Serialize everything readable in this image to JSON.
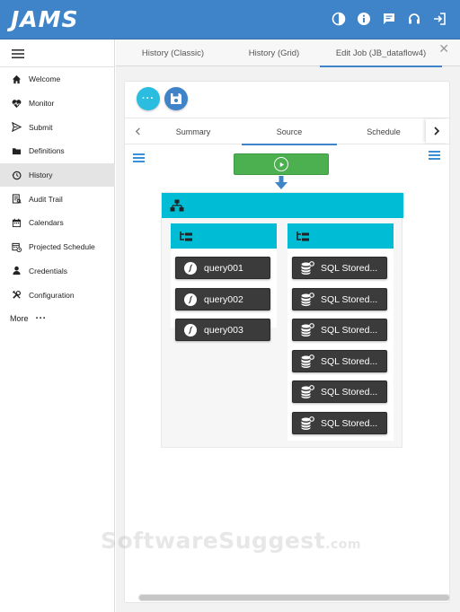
{
  "app": {
    "logo": "JAMS"
  },
  "header": {
    "icons": [
      "contrast-icon",
      "info-icon",
      "chat-icon",
      "headset-icon",
      "logout-icon"
    ]
  },
  "sidebar": {
    "items": [
      {
        "label": "Welcome",
        "icon": "home-icon"
      },
      {
        "label": "Monitor",
        "icon": "heart-pulse-icon"
      },
      {
        "label": "Submit",
        "icon": "send-icon"
      },
      {
        "label": "Definitions",
        "icon": "folder-icon"
      },
      {
        "label": "History",
        "icon": "history-icon",
        "active": true
      },
      {
        "label": "Audit Trail",
        "icon": "audit-icon"
      },
      {
        "label": "Calendars",
        "icon": "calendar-icon"
      },
      {
        "label": "Projected Schedule",
        "icon": "projected-schedule-icon"
      },
      {
        "label": "Credentials",
        "icon": "user-icon"
      },
      {
        "label": "Configuration",
        "icon": "tools-icon"
      }
    ],
    "more_label": "More",
    "more_dots": "..."
  },
  "tabs": [
    {
      "label": "History (Classic)"
    },
    {
      "label": "History (Grid)"
    },
    {
      "label": "Edit Job (JB_dataflow4)",
      "active": true
    }
  ],
  "tab_close": "✕",
  "toolbar": {
    "more_label": "···"
  },
  "subtabs": [
    {
      "label": "Summary"
    },
    {
      "label": "Source",
      "active": true
    },
    {
      "label": "Schedule"
    }
  ],
  "workflow": {
    "left_branch": {
      "tasks": [
        {
          "label": "query001"
        },
        {
          "label": "query002"
        },
        {
          "label": "query003"
        }
      ]
    },
    "right_branch": {
      "tasks": [
        {
          "label": "SQL Stored..."
        },
        {
          "label": "SQL Stored..."
        },
        {
          "label": "SQL Stored..."
        },
        {
          "label": "SQL Stored..."
        },
        {
          "label": "SQL Stored..."
        },
        {
          "label": "SQL Stored..."
        }
      ]
    }
  },
  "watermark": {
    "main": "SoftwareSuggest",
    "suffix": ".com"
  },
  "colors": {
    "header": "#3f84c8",
    "accent_cyan": "#00bcd4",
    "start_green": "#4caf50",
    "task_dark": "#3b3b3b"
  }
}
